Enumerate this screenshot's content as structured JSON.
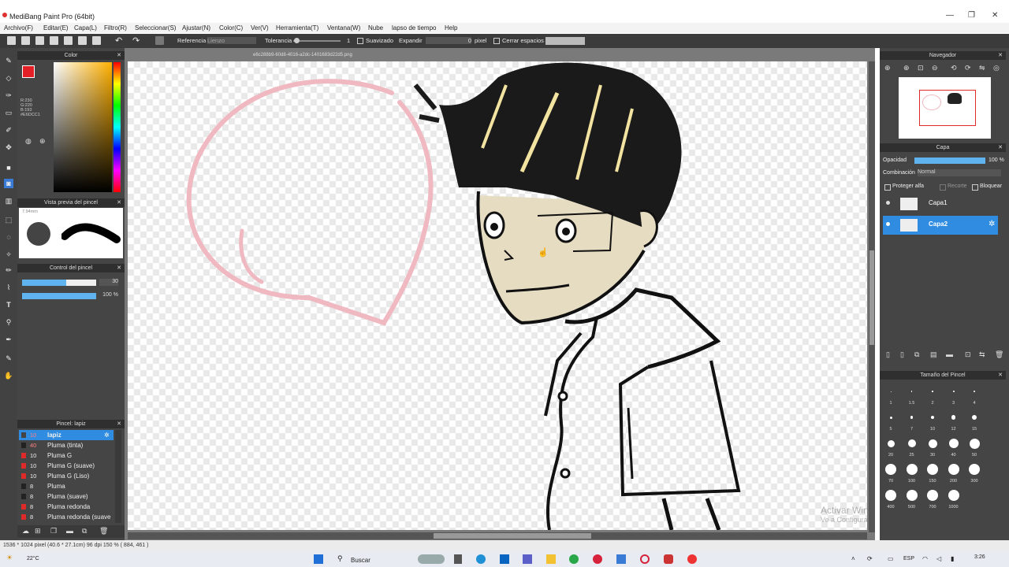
{
  "window": {
    "title": "MediBang Paint Pro (64bit)"
  },
  "menu": [
    "Archivo(F)",
    "Editar(E)",
    "Capa(L)",
    "Filtro(R)",
    "Seleccionar(S)",
    "Ajustar(N)",
    "Color(C)",
    "Ver(V)",
    "Herramienta(T)",
    "Ventana(W)",
    "Nube",
    "lapso de tiempo",
    "Help"
  ],
  "toolbar": {
    "referencia_label": "Referencia",
    "referencia_value": "Lienzo",
    "tolerancia_label": "Tolerancia",
    "tolerancia_value": "1",
    "suavizado_label": "Suavizado",
    "expandir_label": "Expandir",
    "expandir_value": "0",
    "pixel_label": "pixel",
    "cerrar_label": "Cerrar espacios"
  },
  "canvas": {
    "tab": "e6c288b9-60d8-4016-a2dc-1401683d22d5.png"
  },
  "color_panel": {
    "title": "Color",
    "readout": [
      "R:230",
      "G:220",
      "B:193",
      "#E6DCC1"
    ],
    "accent": "#e51f26"
  },
  "brush_preview": {
    "title": "Vista previa del pincel",
    "size": "7.94mm"
  },
  "brush_control": {
    "title": "Control del pincel",
    "size_value": "30",
    "opacity_value": "100 %",
    "size_level": 0.6,
    "opacity_level": 1.0
  },
  "brush_list": {
    "title": "Pincel: lapiz",
    "items": [
      {
        "n": "10",
        "label": "lapiz",
        "color": "#e02a2a",
        "selected": true
      },
      {
        "n": "40",
        "label": "Pluma (tinta)",
        "color": "#222222"
      },
      {
        "n": "10",
        "label": "Pluma G",
        "color": "#e02a2a"
      },
      {
        "n": "10",
        "label": "Pluma G (suave)",
        "color": "#e02a2a"
      },
      {
        "n": "10",
        "label": "Pluma G (Liso)",
        "color": "#e02a2a"
      },
      {
        "n": "8",
        "label": "Pluma",
        "color": "#222222"
      },
      {
        "n": "8",
        "label": "Pluma (suave)",
        "color": "#222222"
      },
      {
        "n": "8",
        "label": "Pluma redonda",
        "color": "#e02a2a"
      },
      {
        "n": "8",
        "label": "Pluma redonda (suave",
        "color": "#e02a2a"
      }
    ]
  },
  "navigator": {
    "title": "Navegador"
  },
  "layers": {
    "title": "Capa",
    "opacity_label": "Opacidad",
    "opacity_value": "100 %",
    "opacity_level": 1.0,
    "blend_label": "Combinación",
    "blend_value": "Normal",
    "protect_label": "Proteger alfa",
    "clip_label": "Recorte",
    "lock_label": "Bloquear",
    "items": [
      {
        "name": "Capa1",
        "selected": false
      },
      {
        "name": "Capa2",
        "selected": true
      }
    ]
  },
  "brush_size": {
    "title": "Tamaño del Pincel",
    "labels": [
      "1",
      "1.5",
      "2",
      "3",
      "4",
      "5",
      "7",
      "10",
      "12",
      "15",
      "20",
      "25",
      "30",
      "40",
      "50",
      "70",
      "100",
      "150",
      "200",
      "300",
      "400",
      "500",
      "700",
      "1000"
    ]
  },
  "watermark": {
    "line1": "Activar Windows",
    "line2": "Ve a Configuración para activar Windows."
  },
  "status": {
    "text": "1536 * 1024 pixel  (40.6 * 27.1cm)  96 dpi  150 %  ( 884, 461 )"
  },
  "taskbar": {
    "temp": "22°C",
    "search": "Buscar",
    "lang": "ESP",
    "time": "3:26"
  }
}
